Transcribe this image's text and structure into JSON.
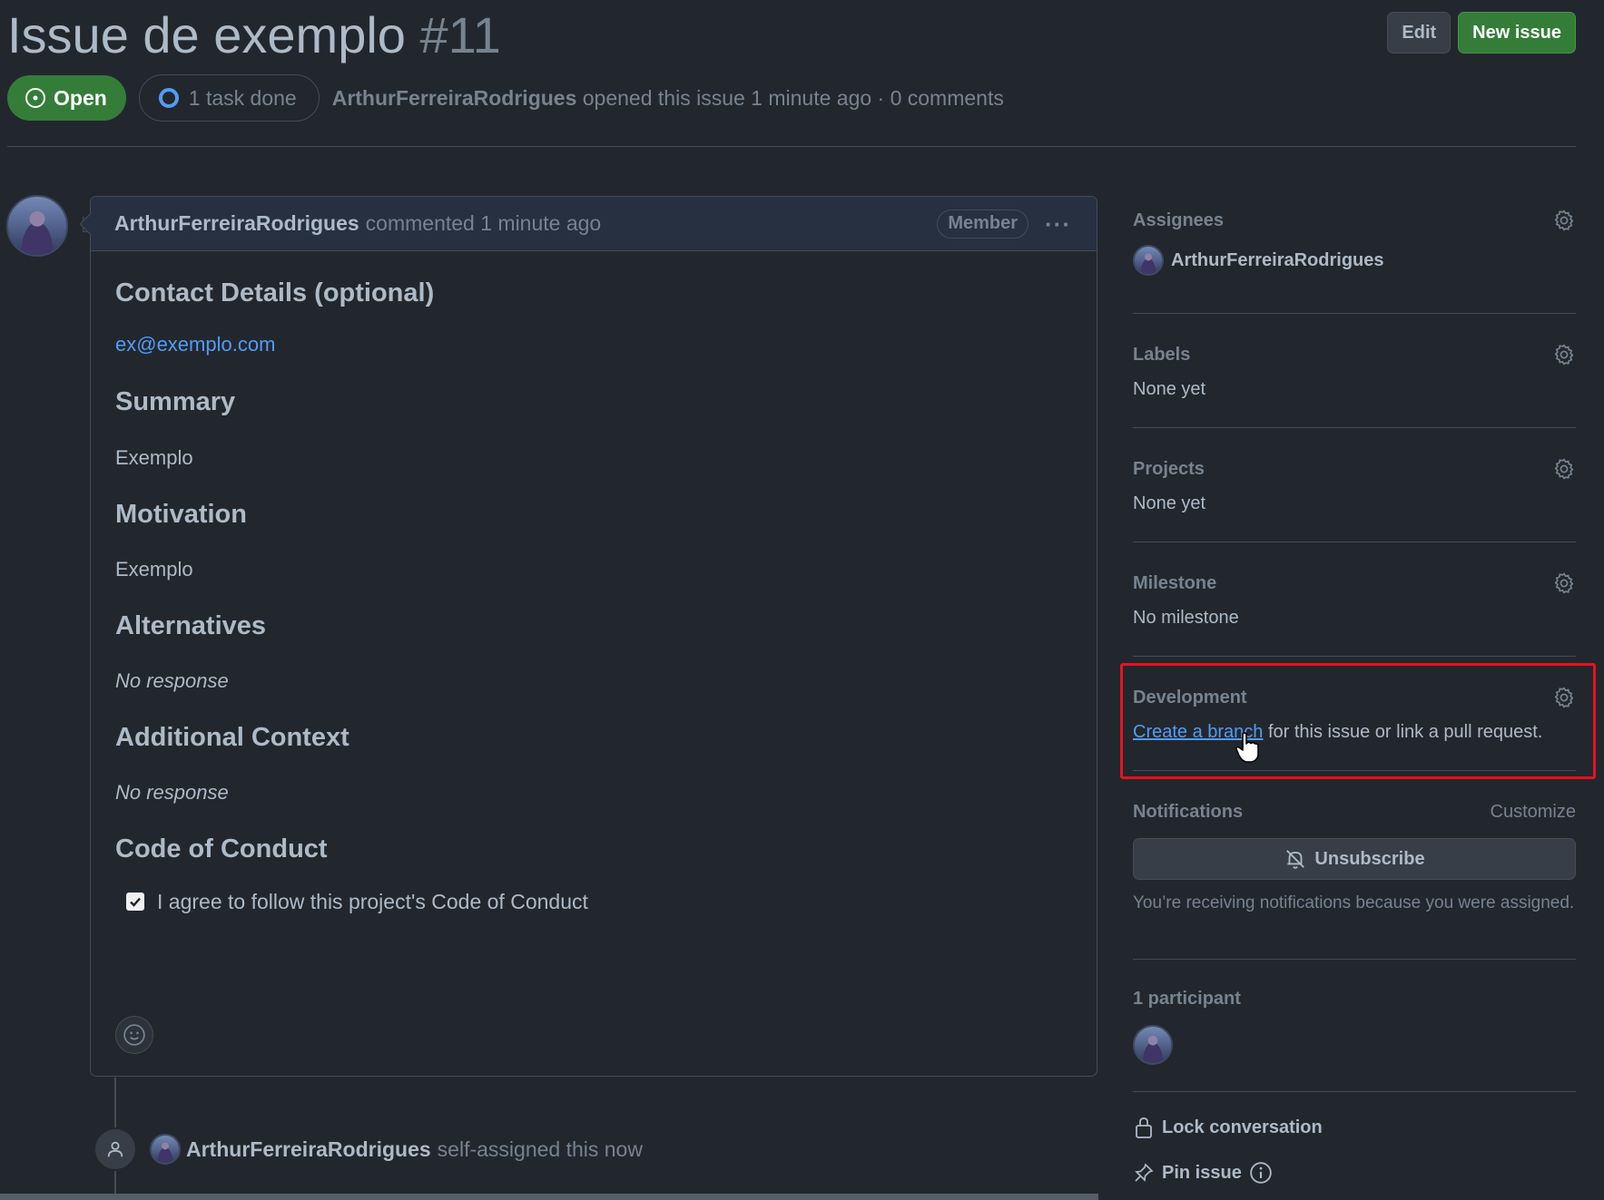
{
  "issue": {
    "title": "Issue de exemplo",
    "number": "#11",
    "state": "Open",
    "tasks": "1 task done",
    "author": "ArthurFerreiraRodrigues",
    "meta": "opened this issue 1 minute ago · 0 comments"
  },
  "header_buttons": {
    "edit": "Edit",
    "new_issue": "New issue"
  },
  "comment": {
    "author": "ArthurFerreiraRodrigues",
    "action": "commented 1 minute ago",
    "role_badge": "Member",
    "sections": {
      "contact_heading": "Contact Details (optional)",
      "contact_value": "ex@exemplo.com",
      "summary_heading": "Summary",
      "summary_value": "Exemplo",
      "motivation_heading": "Motivation",
      "motivation_value": "Exemplo",
      "alternatives_heading": "Alternatives",
      "alternatives_value": "No response",
      "context_heading": "Additional Context",
      "context_value": "No response",
      "conduct_heading": "Code of Conduct",
      "conduct_check": "I agree to follow this project's Code of Conduct"
    }
  },
  "timeline": {
    "author": "ArthurFerreiraRodrigues",
    "action": "self-assigned this now"
  },
  "sidebar": {
    "assignees_label": "Assignees",
    "assignee_name": "ArthurFerreiraRodrigues",
    "labels_label": "Labels",
    "labels_value": "None yet",
    "projects_label": "Projects",
    "projects_value": "None yet",
    "milestone_label": "Milestone",
    "milestone_value": "No milestone",
    "development_label": "Development",
    "development_link": "Create a branch",
    "development_text": " for this issue or link a pull request.",
    "notifications_label": "Notifications",
    "customize": "Customize",
    "unsubscribe": "Unsubscribe",
    "notif_note": "You’re receiving notifications because you were assigned.",
    "participants_label": "1 participant",
    "lock": "Lock conversation",
    "pin": "Pin issue"
  },
  "colors": {
    "background": "#22272e",
    "accent_green": "#347d39",
    "link_blue": "#539bf5",
    "highlight_red": "#e5131f"
  },
  "icons": [
    "issue-opened-icon",
    "progress-circle-icon",
    "kebab-horizontal-icon",
    "gear-icon",
    "bell-slash-icon",
    "lock-icon",
    "pin-icon",
    "info-icon",
    "smiley-icon",
    "person-icon",
    "check-icon",
    "hand-pointer-cursor-icon"
  ]
}
